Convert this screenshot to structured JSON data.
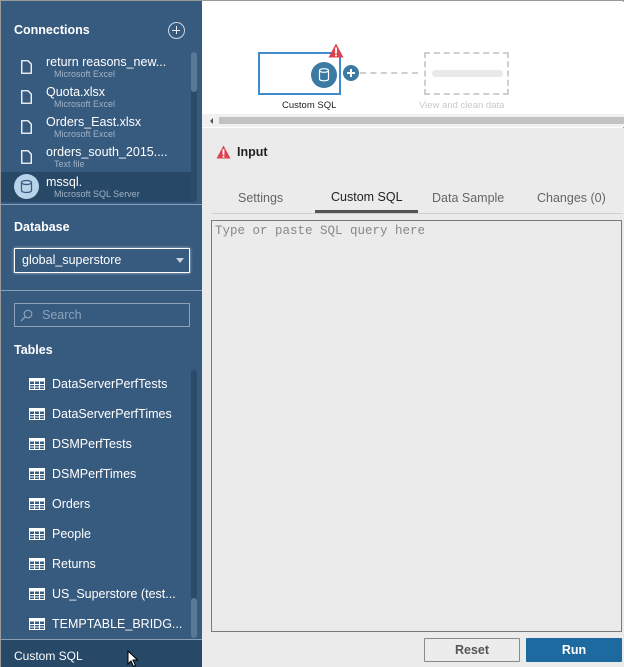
{
  "sidebar": {
    "connections_heading": "Connections",
    "connections": [
      {
        "name": "return reasons_new...",
        "type": "Microsoft Excel",
        "icon": "file-icon",
        "selected": false
      },
      {
        "name": "Quota.xlsx",
        "type": "Microsoft Excel",
        "icon": "file-icon",
        "selected": false
      },
      {
        "name": "Orders_East.xlsx",
        "type": "Microsoft Excel",
        "icon": "file-icon",
        "selected": false
      },
      {
        "name": "orders_south_2015....",
        "type": "Text file",
        "icon": "file-icon",
        "selected": false
      },
      {
        "name": "mssql.",
        "type": "Microsoft SQL Server",
        "icon": "database-icon",
        "selected": true
      }
    ],
    "database_heading": "Database",
    "database_selected": "global_superstore",
    "search_placeholder": "Search",
    "tables_heading": "Tables",
    "tables": [
      "DataServerPerfTests",
      "DataServerPerfTimes",
      "DSMPerfTests",
      "DSMPerfTimes",
      "Orders",
      "People",
      "Returns",
      "US_Superstore (test...",
      "TEMPTABLE_BRIDG..."
    ],
    "footer_label": "Custom SQL"
  },
  "flow": {
    "node_label": "Custom SQL",
    "ghost_label": "View and clean data"
  },
  "panel": {
    "title": "Input",
    "tabs": [
      {
        "label": "Settings",
        "active": false
      },
      {
        "label": "Custom SQL",
        "active": true
      },
      {
        "label": "Data Sample",
        "active": false
      },
      {
        "label": "Changes (0)",
        "active": false
      }
    ],
    "sql_placeholder": "Type or paste SQL query here",
    "sql_value": "",
    "reset_label": "Reset",
    "run_label": "Run"
  },
  "colors": {
    "sidebar_bg": "#375a7f",
    "sidebar_selected": "#274866",
    "accent": "#1d6aa0",
    "warning": "#e0414f",
    "node_border": "#3f8ccd"
  }
}
